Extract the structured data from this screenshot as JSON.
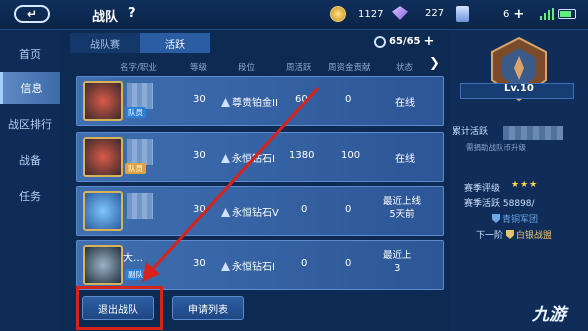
{
  "topbar": {
    "title": "战队",
    "help": "?",
    "resources": [
      {
        "icon": "gold-coin-icon",
        "value": "1127"
      },
      {
        "icon": "diamond-gem-icon",
        "value": "227"
      },
      {
        "icon": "ticket-card-icon",
        "value": "6"
      }
    ],
    "plus": "+"
  },
  "sidenav": {
    "items": [
      {
        "label": "首页",
        "active": false
      },
      {
        "label": "信息",
        "active": true
      },
      {
        "label": "战区排行",
        "active": false
      },
      {
        "label": "战备",
        "active": false
      },
      {
        "label": "任务",
        "active": false
      }
    ]
  },
  "tabs": [
    {
      "label": "战队赛",
      "active": false
    },
    {
      "label": "活跃",
      "active": true
    }
  ],
  "team_count": "65/65",
  "columns": [
    "名字/职业",
    "等级",
    "段位",
    "周活跃",
    "周资金贡献",
    "状态"
  ],
  "members": [
    {
      "role": "队员",
      "level": "30",
      "rank": "尊贵铂金II",
      "weekly_active": "60",
      "fund": "0",
      "status_lines": [
        "在线"
      ]
    },
    {
      "role": "队员",
      "level": "30",
      "rank": "永恒钻石I",
      "weekly_active": "1380",
      "fund": "100",
      "status_lines": [
        "在线"
      ]
    },
    {
      "role": "",
      "level": "30",
      "rank": "永恒钻石V",
      "weekly_active": "0",
      "fund": "0",
      "status_lines": [
        "最近上线",
        "5天前"
      ]
    },
    {
      "role": "副队",
      "name_visible": "大…",
      "level": "30",
      "rank": "永恒钻石I",
      "weekly_active": "0",
      "fund": "0",
      "status_lines": [
        "最近上",
        "3"
      ]
    }
  ],
  "buttons": {
    "leave": "退出战队",
    "apply_list": "申请列表"
  },
  "right_panel": {
    "level": "Lv.10",
    "cumulative_active": "累计活跃",
    "hint": "需捐助战队币升级",
    "season_rating": "赛季评级",
    "stars": "★★★",
    "season_active_label": "赛季活跃",
    "season_active_value": "58898/",
    "current_tier": "青铜军团",
    "next_label": "下一阶",
    "next_tier": "白银战盟"
  },
  "watermark": "九游"
}
